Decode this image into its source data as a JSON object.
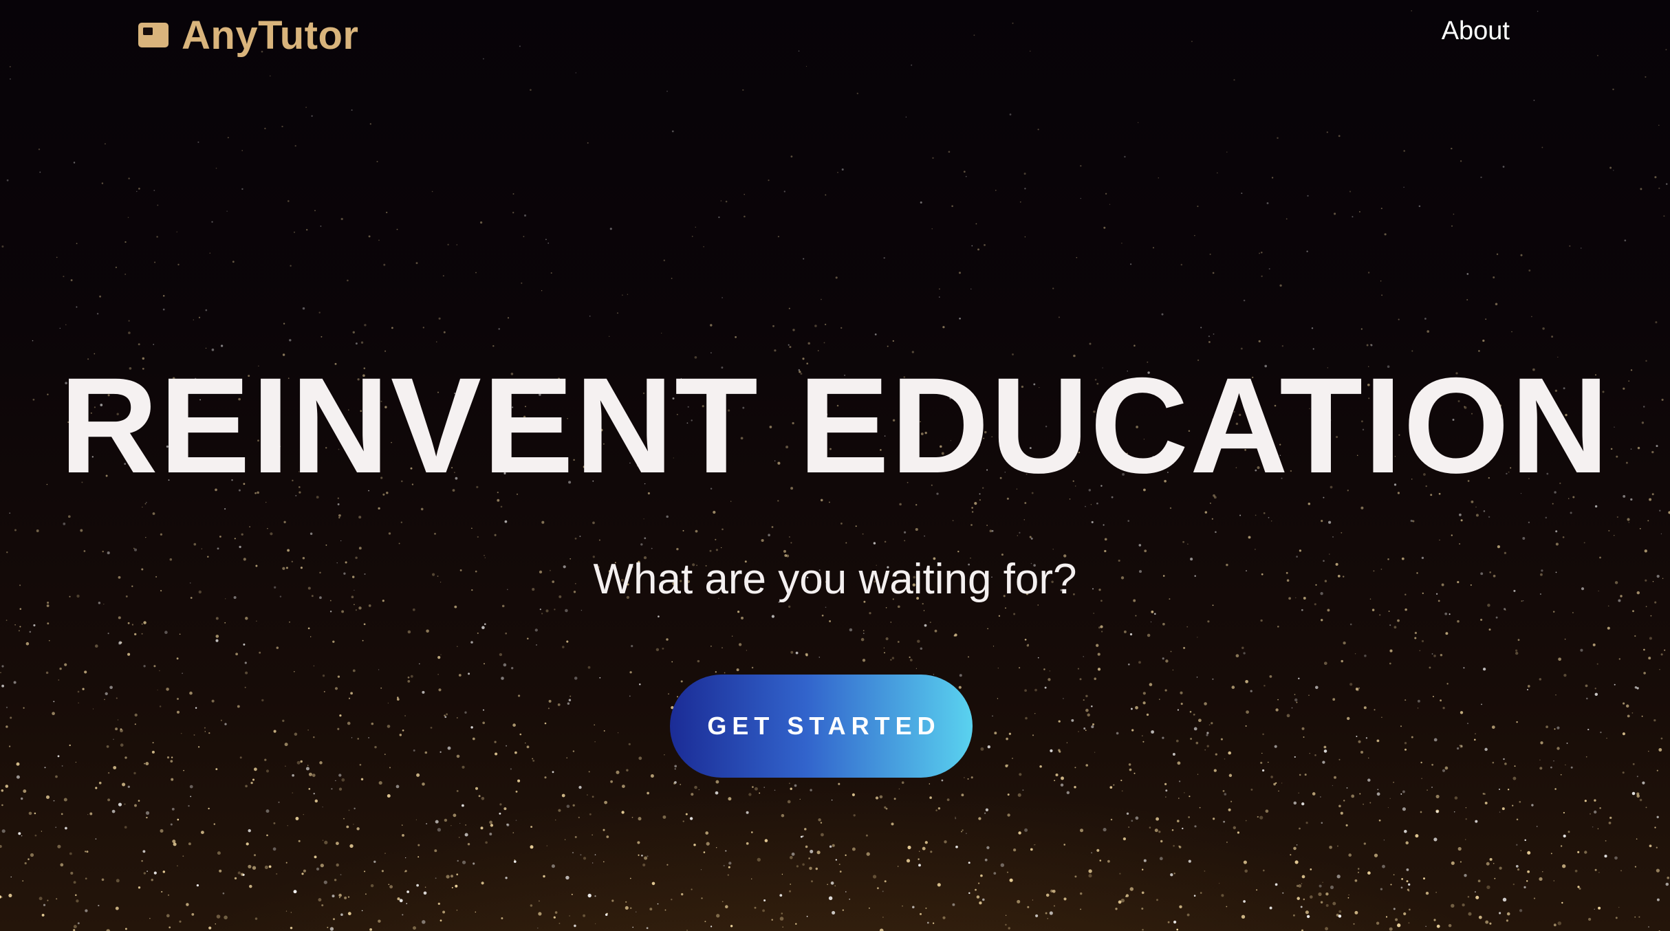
{
  "brand": {
    "name": "AnyTutor",
    "icon": "id-card-icon",
    "color": "#d9b47c"
  },
  "nav": {
    "about_label": "About"
  },
  "hero": {
    "headline": "REINVENT EDUCATION",
    "subheadline": "What are you waiting for?",
    "cta_label": "GET STARTED",
    "cta_gradient": [
      "#1b2c96",
      "#3264cc",
      "#5ad2ef"
    ],
    "background_color": "#0b0509",
    "sparkle_color": "#f3d9a0"
  }
}
